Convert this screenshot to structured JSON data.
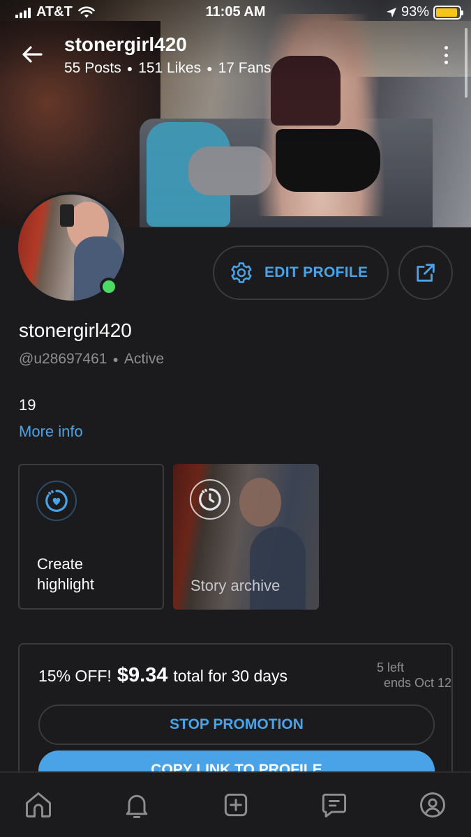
{
  "status_bar": {
    "carrier": "AT&T",
    "time": "11:05 AM",
    "battery": "93%",
    "battery_level": 0.93,
    "icons": [
      "signal-icon",
      "wifi-icon",
      "location-arrow-icon",
      "battery-icon"
    ]
  },
  "header": {
    "title": "stonergirl420",
    "stats": {
      "posts": "55 Posts",
      "likes": "151 Likes",
      "fans": "17 Fans"
    },
    "icons": [
      "back-arrow-icon",
      "more-vertical-icon"
    ]
  },
  "profile": {
    "display_name": "stonergirl420",
    "handle": "@u28697461",
    "status": "Active",
    "bio": "19",
    "more_info": "More info",
    "online_color": "#4cd964"
  },
  "actions": {
    "edit_profile": "EDIT PROFILE",
    "icons": [
      "gear-icon",
      "share-icon"
    ]
  },
  "highlights": [
    {
      "label": "Create highlight",
      "icon": "highlight-heart-icon"
    },
    {
      "label": "Story archive",
      "icon": "clock-icon"
    }
  ],
  "promo": {
    "discount": "15% OFF!",
    "price": "$9.34",
    "duration": "total for 30 days",
    "remaining": "5 left",
    "ends": "ends Oct 12",
    "stop_label": "STOP PROMOTION",
    "copy_label": "COPY LINK TO PROFILE"
  },
  "bottom_nav": {
    "items": [
      "home-icon",
      "bell-icon",
      "add-post-icon",
      "messages-icon",
      "profile-icon"
    ]
  },
  "colors": {
    "background": "#1b1b1d",
    "accent": "#4aa3e6",
    "muted": "#8e8e93",
    "border": "#3a3b3f"
  }
}
